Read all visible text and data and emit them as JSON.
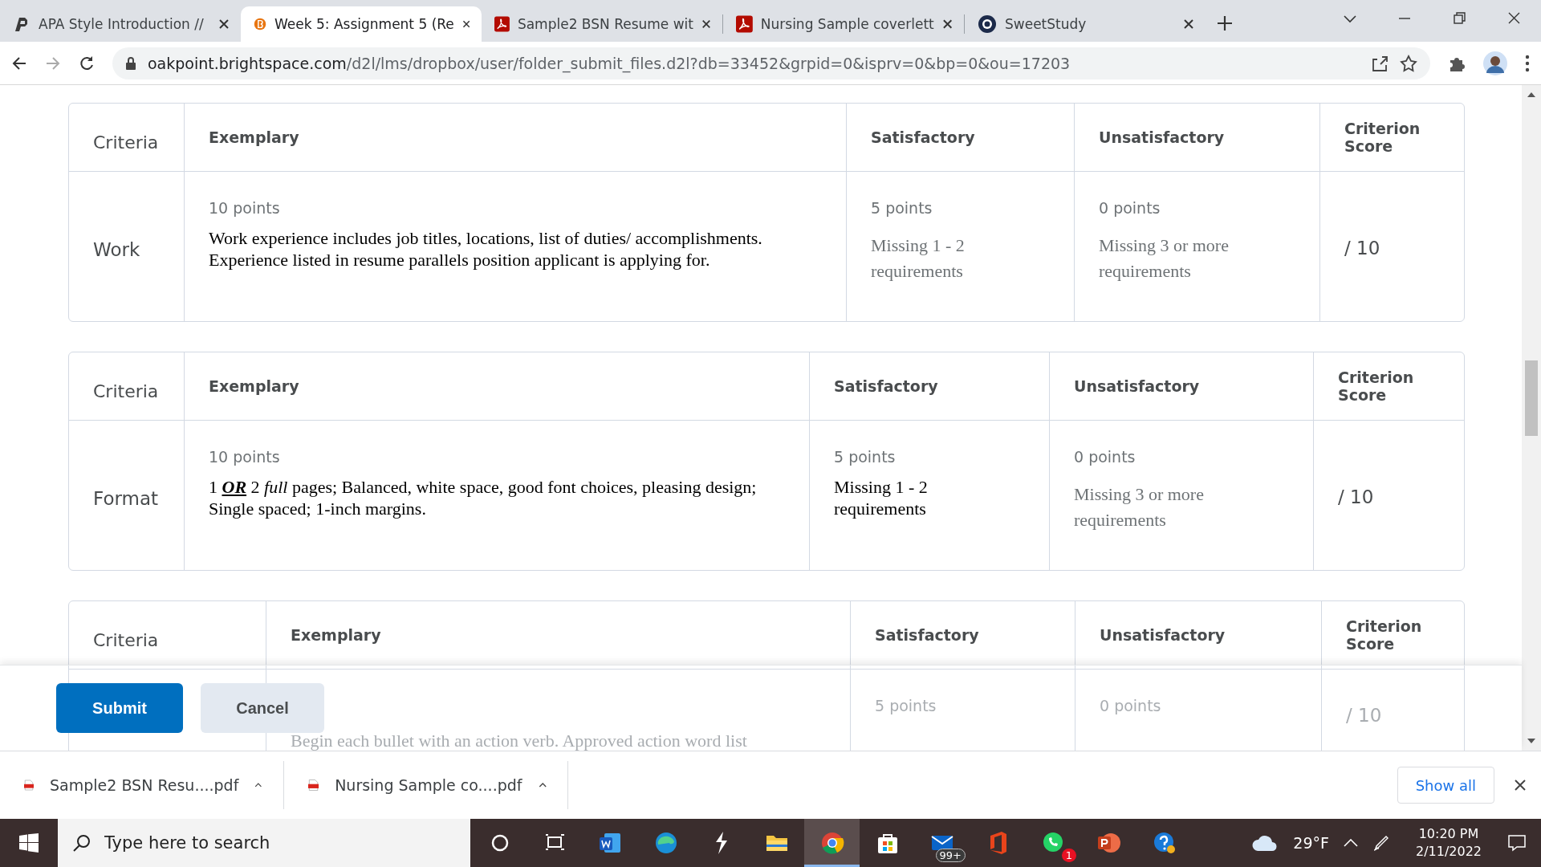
{
  "browser": {
    "tabs": [
      {
        "title": "APA Style Introduction //",
        "selected": false
      },
      {
        "title": "Week 5: Assignment 5 (Re",
        "selected": true
      },
      {
        "title": "Sample2 BSN Resume wit",
        "selected": false
      },
      {
        "title": "Nursing Sample coverlett",
        "selected": false
      },
      {
        "title": "SweetStudy",
        "selected": false
      }
    ],
    "address": {
      "domain": "oakpoint.brightspace.com",
      "path": "/d2l/lms/dropbox/user/folder_submit_files.d2l?db=33452&grpid=0&isprv=0&bp=0&ou=17203"
    }
  },
  "rubrics": [
    {
      "header": {
        "criteria": "Criteria",
        "exemplary": "Exemplary",
        "satisfactory": "Satisfactory",
        "unsatisfactory": "Unsatisfactory",
        "score": "Criterion Score"
      },
      "row": {
        "faded": false,
        "criterion": "Work",
        "score": "/ 10",
        "exemplary": {
          "points": "10 points",
          "description": "Work experience includes job titles, locations, list of duties/ accomplishments. Experience listed in resume parallels position applicant is applying for.",
          "muted": false
        },
        "satisfactory": {
          "points": "5 points",
          "description": "Missing 1 - 2 requirements",
          "muted": true
        },
        "unsatisfactory": {
          "points": "0 points",
          "description": "Missing 3 or more requirements",
          "muted": true
        }
      }
    },
    {
      "header": {
        "criteria": "Criteria",
        "exemplary": "Exemplary",
        "satisfactory": "Satisfactory",
        "unsatisfactory": "Unsatisfactory",
        "score": "Criterion Score"
      },
      "row": {
        "faded": false,
        "criterion": "Format",
        "score": "/ 10",
        "exemplary": {
          "points": "10 points",
          "description": "1 **OR** 2 *full* pages; Balanced, white space, good font choices, pleasing design; Single spaced; 1-inch margins.",
          "muted": false
        },
        "satisfactory": {
          "points": "5 points",
          "description": "Missing 1 - 2 requirements",
          "muted": false
        },
        "unsatisfactory": {
          "points": "0 points",
          "description": "Missing 3 or more requirements",
          "muted": true
        }
      }
    },
    {
      "header": {
        "criteria": "Criteria",
        "exemplary": "Exemplary",
        "satisfactory": "Satisfactory",
        "unsatisfactory": "Unsatisfactory",
        "score": "Criterion Score"
      },
      "row": {
        "faded": true,
        "score": "/ 10",
        "exemplary": {
          "description": "Begin each bullet with an action verb. Approved action word list",
          "muted": false
        },
        "satisfactory": {
          "points": "5 points"
        },
        "unsatisfactory": {
          "points": "0 points"
        }
      }
    }
  ],
  "actions": [
    {
      "label": "Submit",
      "primary": true
    },
    {
      "label": "Cancel",
      "primary": false
    }
  ],
  "downloads": {
    "files": [
      "Sample2 BSN Resu....pdf",
      "Nursing Sample co....pdf"
    ],
    "show_all": "Show all"
  },
  "taskbar": {
    "search": {
      "placeholder": "Type here to search"
    },
    "apps": [
      {
        "kind": "cortana",
        "selected": false
      },
      {
        "kind": "taskview",
        "selected": false
      },
      {
        "kind": "word",
        "selected": false
      },
      {
        "kind": "edge",
        "selected": false
      },
      {
        "kind": "bolt",
        "selected": false
      },
      {
        "kind": "folder",
        "selected": false
      },
      {
        "kind": "chrome",
        "selected": true
      },
      {
        "kind": "store",
        "selected": false
      },
      {
        "kind": "mail",
        "badge": "99+",
        "selected": false
      },
      {
        "kind": "office",
        "selected": false
      },
      {
        "kind": "whatsapp",
        "badge": "1",
        "selected": false
      },
      {
        "kind": "powerpoint",
        "selected": false
      },
      {
        "kind": "help",
        "selected": false
      }
    ],
    "weather": "29°F",
    "time": "10:20 PM",
    "date": "2/11/2022"
  }
}
